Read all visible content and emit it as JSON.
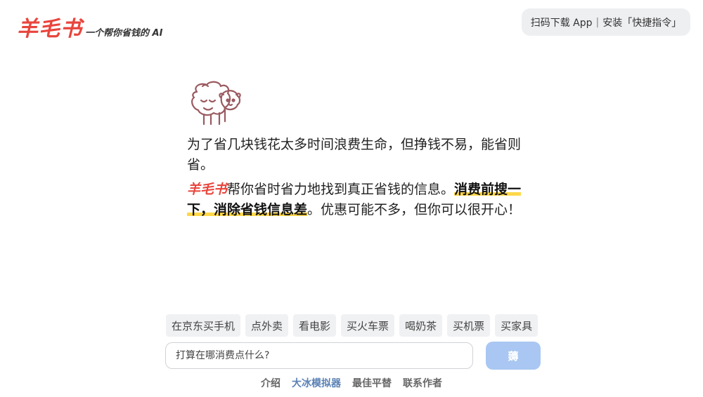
{
  "header": {
    "logo_text": "羊毛书",
    "tagline": "一个帮你省钱的 AI",
    "download_label": "扫码下载 App",
    "separator": "|",
    "shortcut_label": "安装「快捷指令」"
  },
  "intro": {
    "paragraph1": "为了省几块钱花太多时间浪费生命，但挣钱不易，能省则省。",
    "brand": "羊毛书",
    "paragraph2_a": "帮你省时省力地找到真正省钱的信息。",
    "paragraph2_highlight": "消费前搜一下，消除省钱信息差",
    "paragraph2_b": "。优惠可能不多，但你可以很开心！"
  },
  "suggestions": [
    "在京东买手机",
    "点外卖",
    "看电影",
    "买火车票",
    "喝奶茶",
    "买机票",
    "买家具"
  ],
  "search": {
    "placeholder": "打算在哪消费点什么?",
    "submit_label": "薅"
  },
  "footer": {
    "links": [
      {
        "label": "介绍",
        "active": false
      },
      {
        "label": "大冰模拟器",
        "active": true
      },
      {
        "label": "最佳平替",
        "active": false
      },
      {
        "label": "联系作者",
        "active": false
      }
    ]
  },
  "colors": {
    "brand_red": "#e8453c",
    "highlight_yellow": "#ffd84a",
    "button_blue": "#a9c7f2",
    "active_link": "#5b82b5"
  }
}
